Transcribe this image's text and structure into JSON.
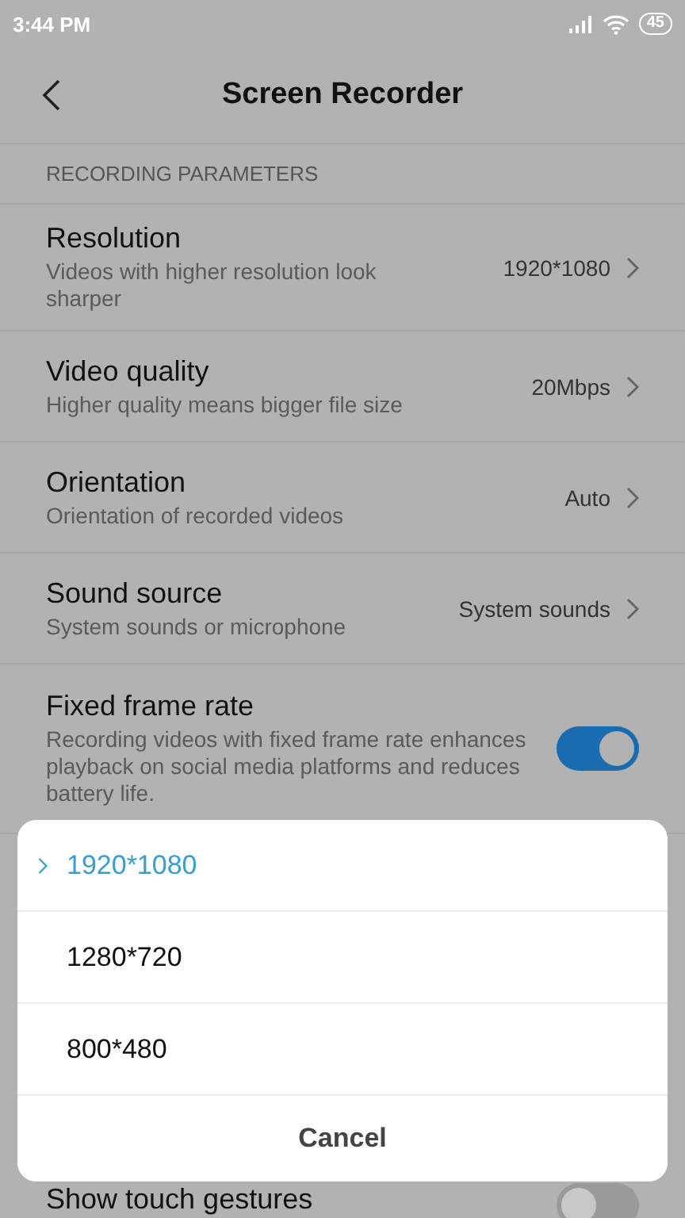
{
  "status_bar": {
    "time": "3:44 PM",
    "battery": "45"
  },
  "header": {
    "title": "Screen Recorder"
  },
  "section": {
    "title": "RECORDING PARAMETERS"
  },
  "settings": [
    {
      "kind": "value",
      "title": "Resolution",
      "subtitle": "Videos with higher resolution look sharper",
      "value": "1920*1080"
    },
    {
      "kind": "value",
      "title": "Video quality",
      "subtitle": "Higher quality means bigger file size",
      "value": "20Mbps"
    },
    {
      "kind": "value",
      "title": "Orientation",
      "subtitle": "Orientation of recorded videos",
      "value": "Auto"
    },
    {
      "kind": "value",
      "title": "Sound source",
      "subtitle": "System sounds or microphone",
      "value": "System sounds"
    },
    {
      "kind": "toggle",
      "title": "Fixed frame rate",
      "subtitle": "Recording videos with fixed frame rate enhances playback on social media platforms and reduces battery life.",
      "on": true
    }
  ],
  "bottom_setting": {
    "title": "Show touch gestures",
    "on": false
  },
  "dialog": {
    "options": [
      {
        "label": "1920*1080",
        "selected": true
      },
      {
        "label": "1280*720",
        "selected": false
      },
      {
        "label": "800*480",
        "selected": false
      }
    ],
    "cancel": "Cancel"
  }
}
